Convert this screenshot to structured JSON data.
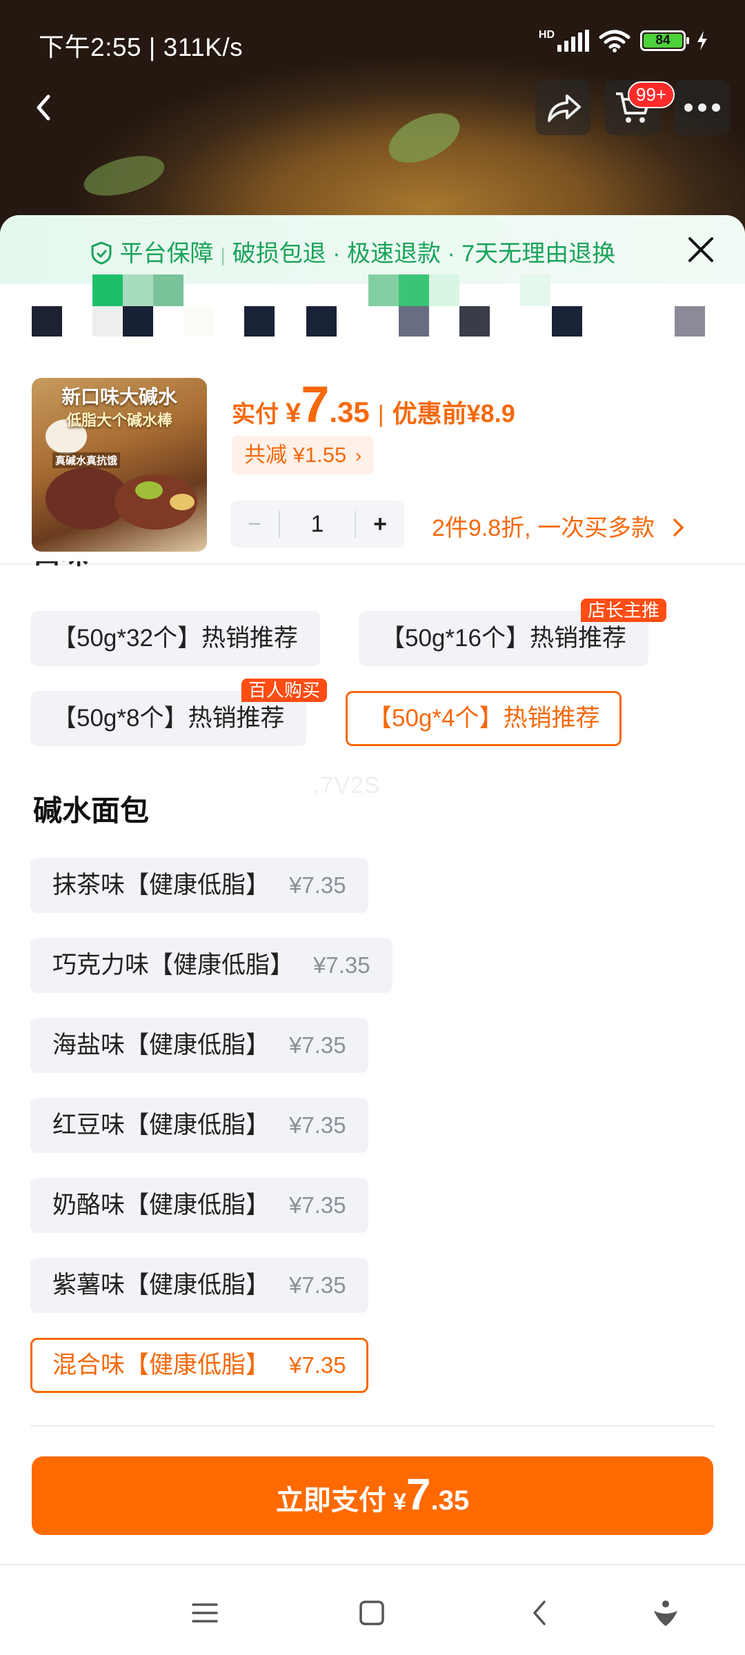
{
  "status_bar": {
    "time_speed": "下午2:55 | 311K/s",
    "network_label": "HD",
    "battery_level": "84"
  },
  "nav": {
    "cart_badge": "99+"
  },
  "guarantee": {
    "title": "平台保障",
    "item1": "破损包退",
    "item2": "极速退款",
    "item3": "7天无理由退换"
  },
  "product": {
    "image_caption_1": "新口味大碱水",
    "image_caption_2": "低脂大个碱水棒",
    "image_caption_3": "真碱水真抗饿",
    "price_label": "实付",
    "currency": "¥",
    "price_int": "7",
    "price_dec": ".35",
    "orig_label": "优惠前",
    "orig_price": "¥8.9",
    "discount": "共减 ¥1.55",
    "quantity": "1",
    "promo": "2件9.8折, 一次买多款"
  },
  "section1": {
    "title_fragment": "口味"
  },
  "sizes": [
    {
      "label": "【50g*32个】热销推荐"
    },
    {
      "label": "【50g*16个】热销推荐",
      "tag": "店长主推"
    },
    {
      "label": "【50g*8个】热销推荐",
      "tag": "百人购买"
    },
    {
      "label": "【50g*4个】热销推荐",
      "selected": true
    }
  ],
  "section2": {
    "title": "碱水面包",
    "watermark": ".7V2S"
  },
  "flavors": [
    {
      "label": "抹茶味【健康低脂】",
      "price": "¥7.35"
    },
    {
      "label": "巧克力味【健康低脂】",
      "price": "¥7.35"
    },
    {
      "label": "海盐味【健康低脂】",
      "price": "¥7.35"
    },
    {
      "label": "红豆味【健康低脂】",
      "price": "¥7.35"
    },
    {
      "label": "奶酪味【健康低脂】",
      "price": "¥7.35"
    },
    {
      "label": "紫薯味【健康低脂】",
      "price": "¥7.35"
    },
    {
      "label": "混合味【健康低脂】",
      "price": "¥7.35",
      "selected": true
    }
  ],
  "pay_button": {
    "label": "立即支付",
    "currency": "¥",
    "int": "7",
    "dec": ".35"
  },
  "colors": {
    "accent": "#ff6a00",
    "accent_text": "#f5690c",
    "guarantee_green": "#1aa35a",
    "tag_red": "#ff4d14"
  },
  "icons": [
    "back-arrow-icon",
    "share-icon",
    "cart-icon",
    "more-icon",
    "shield-check-icon",
    "close-icon",
    "chevron-right-icon",
    "menu-icon",
    "home-icon",
    "back-icon",
    "assistant-icon"
  ]
}
